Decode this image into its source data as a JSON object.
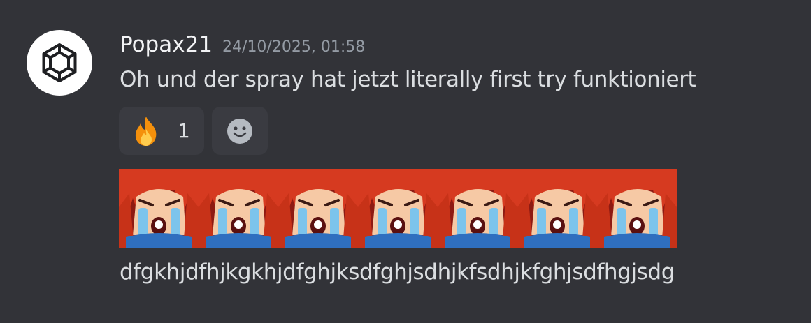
{
  "message": {
    "avatar_icon": "hexagon-gem-icon",
    "username": "Popax21",
    "timestamp": "24/10/2025, 01:58",
    "text": "Oh und der spray hat jetzt literally first try funktioniert",
    "reactions": [
      {
        "icon": "fire-emoji-icon",
        "count": "1"
      },
      {
        "icon": "add-reaction-smiley-icon",
        "count": ""
      }
    ],
    "emotes": [
      {
        "icon": "crying-anime-girl-emote-icon"
      },
      {
        "icon": "crying-anime-girl-emote-icon"
      },
      {
        "icon": "crying-anime-girl-emote-icon"
      },
      {
        "icon": "crying-anime-girl-emote-icon"
      },
      {
        "icon": "crying-anime-girl-emote-icon"
      },
      {
        "icon": "crying-anime-girl-emote-icon"
      },
      {
        "icon": "crying-anime-girl-emote-icon"
      }
    ],
    "trailing_text": "dfgkhjdfhjkgkhjdfghjksdfghjsdhjkfsdhjkfghjsdfhgjsdg"
  },
  "colors": {
    "background": "#323338",
    "reaction_bg": "#3a3b41",
    "username": "#f2f3f5",
    "timestamp": "#949ba4",
    "text": "#dbdee1",
    "emote_red": "#d63a20"
  }
}
